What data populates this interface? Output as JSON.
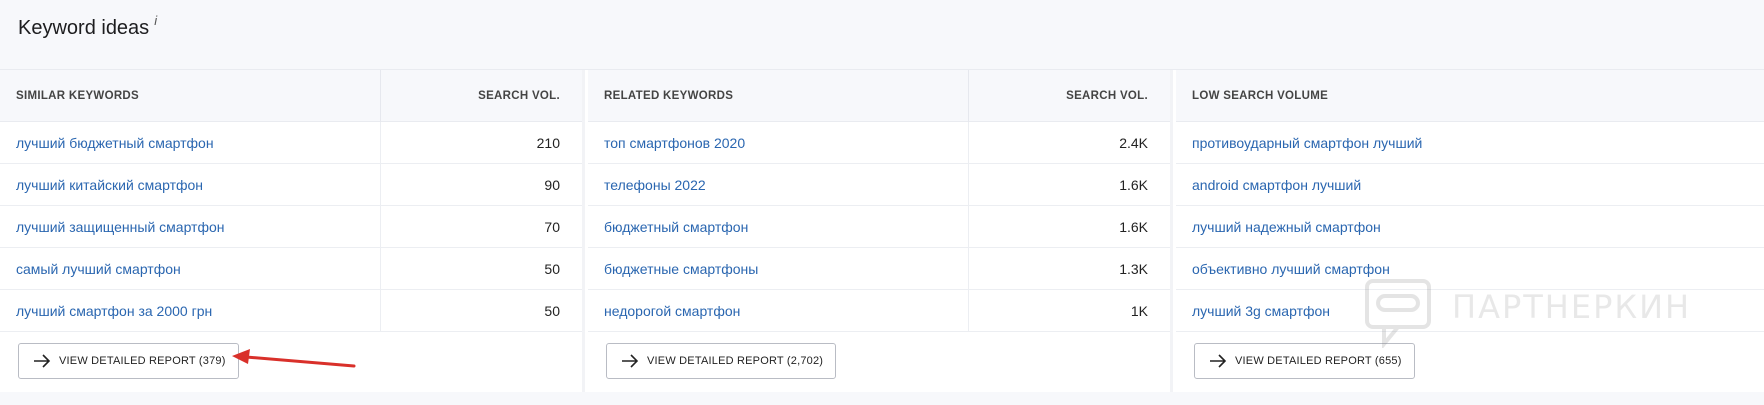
{
  "widget": {
    "title": "Keyword ideas",
    "info_mark": "i"
  },
  "columns": [
    {
      "header": {
        "keyword": "SIMILAR KEYWORDS",
        "volume": "SEARCH VOL."
      },
      "rows": [
        {
          "keyword": "лучший бюджетный смартфон",
          "volume": "210"
        },
        {
          "keyword": "лучший китайский смартфон",
          "volume": "90"
        },
        {
          "keyword": "лучший защищенный смартфон",
          "volume": "70"
        },
        {
          "keyword": "самый лучший смартфон",
          "volume": "50"
        },
        {
          "keyword": "лучший смартфон за 2000 грн",
          "volume": "50"
        }
      ],
      "button": "VIEW DETAILED REPORT (379)"
    },
    {
      "header": {
        "keyword": "RELATED KEYWORDS",
        "volume": "SEARCH VOL."
      },
      "rows": [
        {
          "keyword": "топ смартфонов 2020",
          "volume": "2.4K"
        },
        {
          "keyword": "телефоны 2022",
          "volume": "1.6K"
        },
        {
          "keyword": "бюджетный смартфон",
          "volume": "1.6K"
        },
        {
          "keyword": "бюджетные смартфоны",
          "volume": "1.3K"
        },
        {
          "keyword": "недорогой смартфон",
          "volume": "1K"
        }
      ],
      "button": "VIEW DETAILED REPORT (2,702)"
    },
    {
      "header": {
        "keyword": "LOW SEARCH VOLUME"
      },
      "rows": [
        {
          "keyword": "противоударный смартфон лучший"
        },
        {
          "keyword": "android смартфон лучший"
        },
        {
          "keyword": "лучший надежный смартфон"
        },
        {
          "keyword": "объективно лучший смартфон"
        },
        {
          "keyword": "лучший 3g смартфон"
        }
      ],
      "button": "VIEW DETAILED REPORT (655)"
    }
  ],
  "watermark": {
    "text": "ПАРТНЕРКИН"
  },
  "colors": {
    "link": "#2a66b0",
    "annotation_arrow": "#d9302a",
    "header_bg": "#f7f8fb"
  }
}
